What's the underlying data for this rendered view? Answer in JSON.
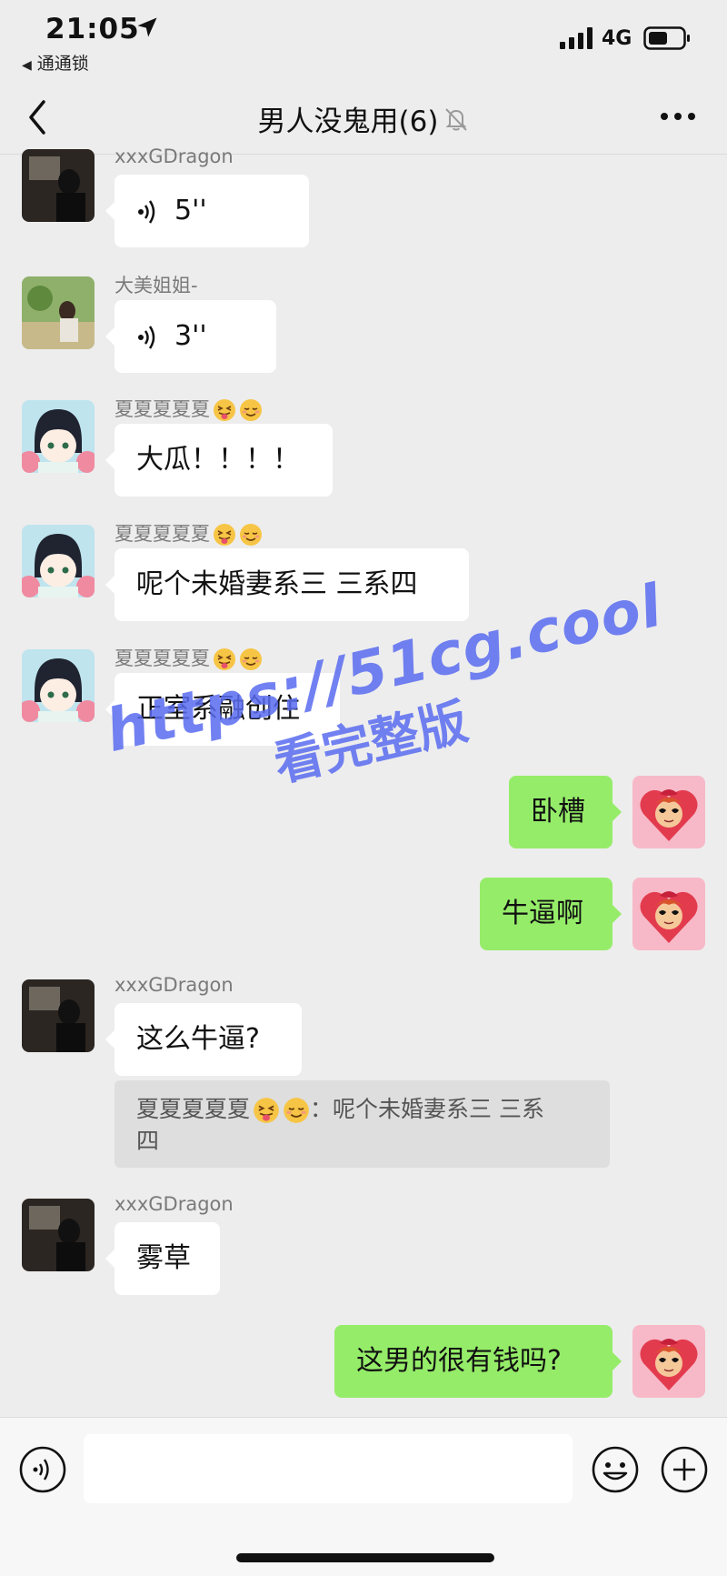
{
  "status_bar": {
    "time": "21:05",
    "back_app": "通通锁",
    "network": "4G"
  },
  "nav": {
    "title": "男人没鬼用(6)"
  },
  "messages": [
    {
      "sender": "xxxGDragon",
      "type": "voice",
      "duration": "5''"
    },
    {
      "sender": "大美姐姐-",
      "type": "voice",
      "duration": "3''"
    },
    {
      "sender": "夏夏夏夏夏",
      "sender_emoji": [
        "squint-tongue-emoji",
        "relieved-emoji"
      ],
      "text": "大瓜！！！！"
    },
    {
      "sender": "夏夏夏夏夏",
      "sender_emoji": [
        "squint-tongue-emoji",
        "relieved-emoji"
      ],
      "text": "呢个未婚妻系三 三系四"
    },
    {
      "sender": "夏夏夏夏夏",
      "sender_emoji": [
        "squint-tongue-emoji",
        "relieved-emoji"
      ],
      "text": "正室系融创住"
    },
    {
      "sender": "me",
      "text": "卧槽"
    },
    {
      "sender": "me",
      "text": "牛逼啊"
    },
    {
      "sender": "xxxGDragon",
      "text": "这么牛逼?"
    },
    {
      "sender": "xxxGDragon",
      "text": "雾草"
    },
    {
      "sender": "me",
      "text": "这男的很有钱吗?"
    }
  ],
  "quote": {
    "sender": "夏夏夏夏夏",
    "text_line1": "：呢个未婚妻系三 三系",
    "text_line2": "四"
  },
  "watermark": {
    "line1": "https://51cg.cool",
    "line2": "看完整版"
  },
  "colors": {
    "background": "#ededed",
    "outgoing_bubble": "#95ec69",
    "incoming_bubble": "#ffffff",
    "watermark": "#5a6cf0"
  }
}
